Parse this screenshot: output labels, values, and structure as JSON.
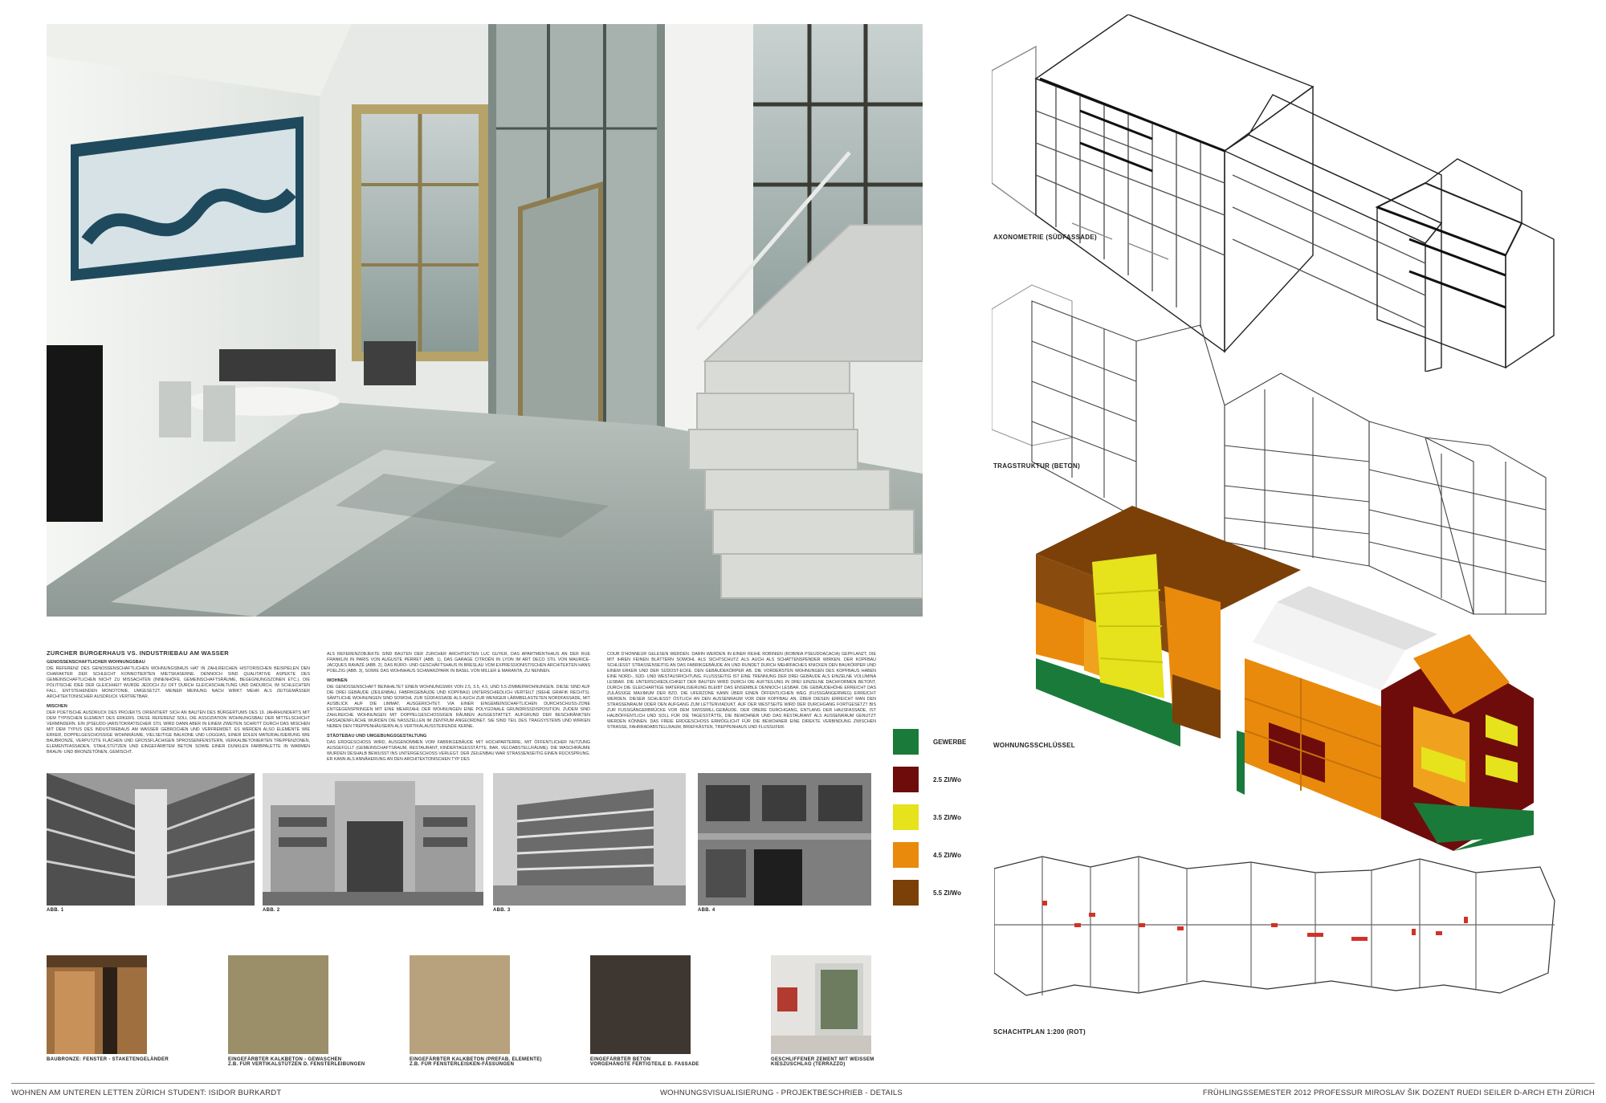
{
  "main_title": "ZÜRCHER BÜRGERHAUS VS. INDUSTRIEBAU AM WASSER",
  "columns": [
    {
      "sections": [
        {
          "heading": "GENOSSENSCHAFTLICHER WOHNUNGSBAU",
          "body": "DIE REFERENZ DES GENOSSENSCHAFTLICHEN WOHNUNGSBAUS HAT IN ZAHLREICHEN HISTORISCHEN BEISPIELEN DEN CHARAKTER DER SCHLECHT KONNOTIERTEN MIETSKASERNE. DENNOCH SIND QUALITATIVE ASPEKTE DES GEMEINSCHAFTLICHEN NICHT ZU MISSACHTEN (INNENHÖFE, GEMEINSCHAFTSRÄUME, BEGEGNUNGSZONEN ETC.). DIE POLITISCHE IDEE DER GLEICHHEIT WURDE JEDOCH ZU OFT DURCH GLEICHSCHALTUNG UND DADURCH, IM SCHLECHTEN FALL, ENTSTEHENDEN MONOTONIE, UMGESETZT. MEINER MEINUNG NACH WIRKT MEHR ALS ZEITGEMÄSSER ARCHITEKTONISCHER AUSDRUCK VERTRETBAR."
        },
        {
          "heading": "MISCHEN",
          "body": "DER POETISCHE AUSDRUCK DES PROJEKTS ORIENTIERT SICH AN BAUTEN DES BÜRGERTUMS DES 19. JAHRHUNDERTS MIT DEM TYPISCHEN ELEMENT DES ERKERS. DIESE REFERENZ SOLL DIE ASSOZIATION WOHNUNGSBAU DER MITTELSCHICHT VERMINDERN. EIN (PSEUDO-)ARISTOKRATISCHER STIL WIRD DANN ABER IN EINEM ZWEITEN SCHRITT DURCH DAS MISCHEN MIT DEM TYPUS DES INDUSTRIEBAUS AM WASSER GEBROCHEN UND VERFREMDET. ES WERDEN ALSO ELEMENTE WIE ERKER, DOPPELGESCHOSSIGE WOHNRÄUME, VIELSEITIGE BALKONE UND LOGGIAS, EINER EDLEN MATERIALISIERUNG WIE BAUBRONZE, VERPUTZTE FLÄCHEN UND GROSSFLÄCHIGEN SPROSSENFENSTERN, VERKALBETONIERTEN TREPPENZONEN, ELEMENTFASSADEN, STAHLSTÜTZEN UND EINGEFÄRBTEM BETON SOWIE EINER DUNKLEN FARBPALETTE IN WARMEN BRAUN- UND BRONZETÖNEN, GEMISCHT."
        }
      ]
    },
    {
      "sections": [
        {
          "heading": "",
          "body": "ALS REFERENZOBJEKTE SIND BAUTEN DER ZÜRCHER ARCHITEKTEN LUC GUYER, DAS APARTMENTHAUS AN DER RUE FRANKLIN IN PARIS VON AUGUSTE PERRET (ABB. 1), DAS GARAGE CITROËN IN LYON IM ART DECO STIL VON MAURICE-JACQUES RAVAZÉ (ABB. 2), DAS BÜRO- UND GESCHÄFTSHAUS IN BRESLAU VOM EXPRESSIONISTISCHEN ARCHITEKTEN HANS POELZIG (ABB. 3), SOWIE DAS WOHNHAUS SCHWARZPARK IN BASEL VON MILLER & MARANTA, ZU NENNEN."
        },
        {
          "heading": "WOHNEN",
          "body": "DIE GENOSSENSCHAFT BEINHALTET EINEN WOHNUNGSMIX VON 2.5, 3.5, 4.5, UND 5.5-ZIMMERWOHNUNGEN. DIESE SIND AUF DIE DREI GEBÄUDE (ZEILENBAU, FABRIKGEBÄUDE UND KOPFBAU) UNTERSCHIEDLICH VERTEILT (SIEHE GRAFIK RECHTS). SÄMTLICHE WOHNUNGEN SIND SOWOHL ZUR SÜDFASSADE ALS AUCH ZUR WENIGER LÄRMBELASTETEN NORDFASSADE, MIT AUSBLICK AUF DIE LIMMAT, AUSGERICHTET. VIA EINER EINGEMEINSCHAFTLICHEN DURCHSCHUSS-ZONE ENTGEGENSPRINGEN MIT EINE MEHRZAHL DER WOHNUNGEN EINE POLYGONALE GRUNDRISSDISPOSITION. ZUDEM SIND ZAHLREICHE WOHNUNGEN MIT DOPPELGESCHOSSIGEN RÄUMEN AUSGESTATTET. AUFGRUND DER BESCHRÄNKTEN FASSADENFLÄCHE WURDEN DIE NASSZELLEN IM ZENTRUM ANGEORDNET. SIE SIND TEIL DES TRAGSYSTEMS UND WIRKEN NEBEN DEN TREPPENHÄUSERN ALS VERTIKALAUSSTEIFENDE KERNE."
        },
        {
          "heading": "STÄDTEBAU UND UMGEBUNGSGESTALTUNG",
          "body": "DAS ERDGESCHOSS WIRD, AUSGENOMMEN VOM FABRIKGEBÄUDE MIT HOCHPARTERRE, MIT ÖFFENTLICHER NUTZUNG AUSGEFÜLLT (GEMEINSCHAFTSRAUM, RESTAURANT, KINDERTAGESSTÄTTE, BAR, VELOABSTELLRÄUME). DIE WASCHRÄUME WURDEN DESHALB BEWUSST INS UNTERGESCHOSS VERLEGT. DER ZEILENBAU WAR STRASSENSEITIG EINEN RÜCKSPRUNG. ER KANN ALS ANNÄHERUNG AN DEN ARCHITEKTONISCHEN TYP DES"
        }
      ]
    },
    {
      "sections": [
        {
          "heading": "",
          "body": "COUR D'HONNEUR GELESEN WERDEN. DARIN WERDEN IN EINER REIHE ROBINIEN (ROBINIA PSEUDOACACIA) GEPFLANZT, DIE MIT IHREN FEINEN BLÄTTERN SOWOHL ALS SICHTSCHUTZ ALS AUCH ALS SCHATTENSPENDER WIRKEN. DER KOPFBAU SCHLIESST STRASSENSEITIG AN DAS FABRIKGEBÄUDE AN UND RUNDET DURCH MEHRFACHES KNICKEN DEN BAUKÖRPER UND EINEM ERKER UND DER SÜDOST-ECKE. DEN GEBÄUDEKÖRPER AB. DIE VORDERSTEN WOHNUNGEN DES KOPFBAUS HABEN EINE NORD-, SÜD- UND WESTAUSRICHTUNG. FLUSSSEITIG IST EINE TRENNUNG DER DREI GEBÄUDE ALS EINZELNE VOLUMINA LESBAR. DIE UNTERSCHIEDLICHKEIT DER BAUTEN WIRD DURCH DIE AUFTEILUNG IN DREI EINZELNE DACHFORMEN BETONT, DURCH DIE GLEICHARTIGE MATERIALISIERUNG BLEIBT DAS ENSEMBLE DENNOCH LESBAR. DIE GEBÄUDEHÖHE ERREICHT DAS ZULÄSSIGE MAXIMUM DER BZO. DIE UFERZONE KANN ÜBER EINEN ÖFFENTLICHEN WEG (FUSSGÄNGERWEG) ERREICHT WERDEN. DIESER SCHLIESST ÖSTLICH AN DEN AUSSENRAUM VOR DEM KOPFBAU AN, ÜBER DIESEN ERREICHT MAN DEN STRASSENRAUM ODER DEN AUFGANG ZUM LETTENVIADUKT. AUF DER WESTSEITE WIRD DER DURCHGANG FORTGESETZT BIS ZUR FUSSGÄNGERBRÜCKE VOR DEM SWISSMILL-GEBÄUDE. DER OBERE DURCHGANG, ENTLANG DER HAUSFASSADE, IST HALBÖFFENTLICH UND SOLL FÜR DIE TAGESSTÄTTE, DIE BEWOHNER UND DAS RESTAURANT ALS AUSSENRAUM GENUTZT WERDEN KÖNNEN. DAS FREIE ERDGESCHOSS ERMÖGLICHT FÜR DIE BEWOHNER EINE DIREKTE VERBINDUNG ZWISCHEN STRASSE, FAHRRADABSTELLRAUM, BRIEFKÄSTEN, TREPPENHAUS UND FLUSSUFER."
        }
      ]
    }
  ],
  "reference_images": [
    {
      "caption": "ABB. 1"
    },
    {
      "caption": "ABB. 2"
    },
    {
      "caption": "ABB. 3"
    },
    {
      "caption": "ABB. 4"
    }
  ],
  "materials": [
    {
      "caption_line1": "BAUBRONZE: FENSTER - STAKETENGELÄNDER",
      "caption_line2": "",
      "color": "#9a6a3c"
    },
    {
      "caption_line1": "EINGEFÄRBTER KALKBETON - GEWASCHEN",
      "caption_line2": "Z.B. FÜR VERTIKALSTÜTZEN D. FENSTERLEIBUNGEN",
      "color": "#9b8f6a"
    },
    {
      "caption_line1": "EINGEFÄRBTER KALKBETON (PREFAB. ELEMENTE)",
      "caption_line2": "Z.B. FÜR FENSTERLEISKEN-FASSUNGEN",
      "color": "#b8a27e"
    },
    {
      "caption_line1": "EINGEFÄRBTER BETON",
      "caption_line2": "VORGEHÄNGTE FERTIGTEILE D. FASSADE",
      "color": "#3e3630"
    },
    {
      "caption_line1": "GESCHLIFFENER ZEMENT MIT WEISSEM",
      "caption_line2": "KIESZUSCHLAG (TERRAZZO)",
      "color": "#d8d4cf"
    }
  ],
  "legend": [
    {
      "label": "GEWERBE",
      "color": "#1a7a3a"
    },
    {
      "label": "2.5 ZI/Wo",
      "color": "#6e0c0c"
    },
    {
      "label": "3.5 ZI/Wo",
      "color": "#e6e21c"
    },
    {
      "label": "4.5 ZI/Wo",
      "color": "#e98a0c"
    },
    {
      "label": "5.5 ZI/Wo",
      "color": "#7a4008"
    }
  ],
  "diagram_labels": {
    "axonometrie": "AXONOMETRIE (SÜDFASSADE)",
    "tragstruktur": "TRAGSTRUKTUR (BETON)",
    "wohnungsschluessel": "WOHNUNGSSCHLÜSSEL",
    "schachtplan": "SCHACHTPLAN 1:200 (ROT)"
  },
  "footer": {
    "left": "WOHNEN AM UNTEREN LETTEN ZÜRICH STUDENT: ISIDOR BURKARDT",
    "center": "WOHNUNGSVISUALISIERUNG - PROJEKTBESCHRIEB - DETAILS",
    "right": "FRÜHLINGSSEMESTER 2012 PROFESSUR MIROSLAV ŠIK DOZENT RUEDI SEILER D-ARCH ETH ZÜRICH"
  }
}
